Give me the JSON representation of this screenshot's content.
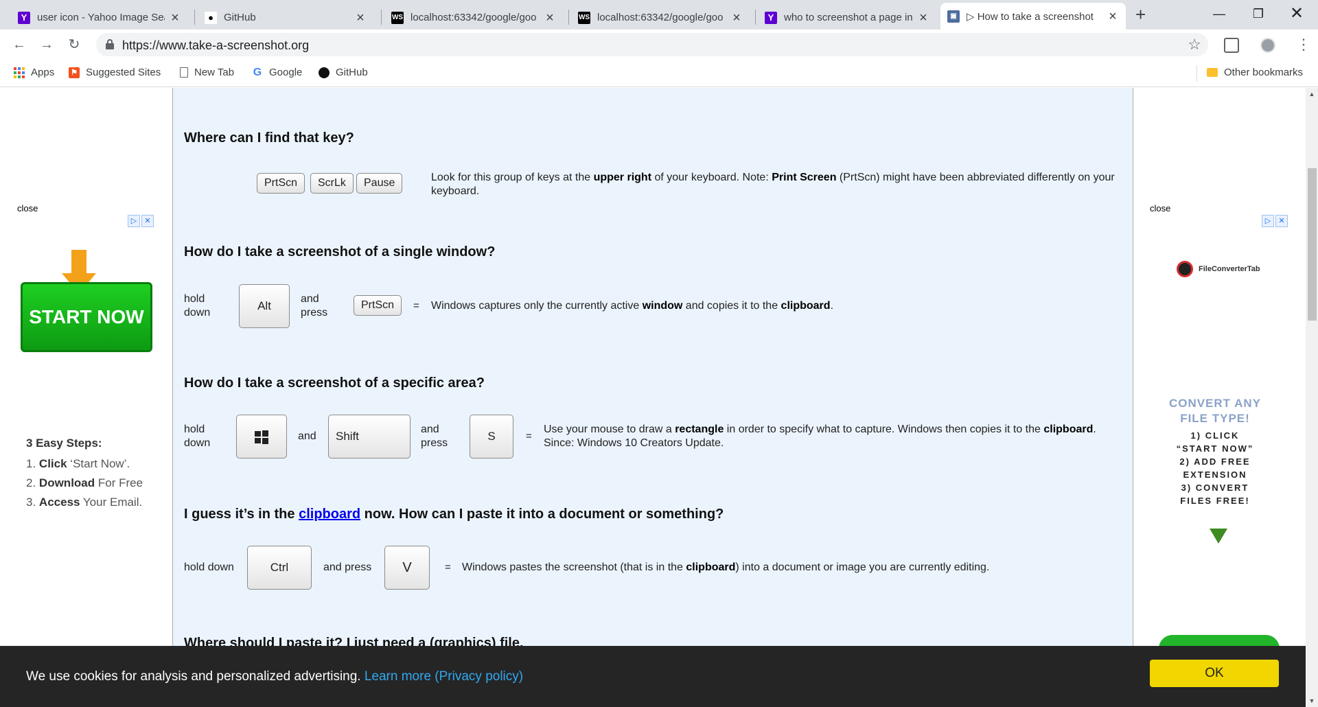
{
  "tabs": [
    {
      "title": "user icon - Yahoo Image Sear",
      "favicon": "yahoo-icon",
      "fav_glyph": "Y"
    },
    {
      "title": "GitHub",
      "favicon": "github-icon",
      "fav_glyph": "●"
    },
    {
      "title": "localhost:63342/google/goo",
      "favicon": "webstorm-icon",
      "fav_glyph": "WS"
    },
    {
      "title": "localhost:63342/google/goo",
      "favicon": "webstorm-icon",
      "fav_glyph": "WS"
    },
    {
      "title": "who to screenshot a page in",
      "favicon": "yahoo-icon",
      "fav_glyph": "Y"
    },
    {
      "title": "▷ How to take a screenshot",
      "favicon": "screenshot-site-icon",
      "fav_glyph": "▣",
      "active": true
    }
  ],
  "browser": {
    "url": "https://www.take-a-screenshot.org",
    "new_tab": "+",
    "close_glyph": "×"
  },
  "bookmarks": {
    "apps": "Apps",
    "suggested": "Suggested Sites",
    "new_tab": "New Tab",
    "google": "Google",
    "github": "GitHub",
    "other": "Other bookmarks"
  },
  "left_ad": {
    "close": "close",
    "cta": "START NOW",
    "steps_title": "3 Easy Steps:",
    "steps": [
      {
        "n": "1.",
        "bold": "Click",
        "rest": "‘Start Now’."
      },
      {
        "n": "2.",
        "bold": "Download",
        "rest": "For Free"
      },
      {
        "n": "3.",
        "bold": "Access",
        "rest": "Your Email."
      }
    ]
  },
  "right_ad": {
    "close": "close",
    "brand": "FileConverterTab",
    "title": "CONVERT ANY FILE TYPE!",
    "steps": [
      "1) CLICK",
      "“START NOW”",
      "2) ADD FREE",
      "EXTENSION",
      "3) CONVERT",
      "FILES FREE!"
    ]
  },
  "article": {
    "q1": "Where can I find that key?",
    "keys1": [
      "PrtScn",
      "ScrLk",
      "Pause"
    ],
    "a1_pre": "Look for this group of keys at the ",
    "a1_b1": "upper right",
    "a1_mid": " of your keyboard. Note: ",
    "a1_b2": "Print Screen",
    "a1_post": " (PrtScn) might have been abbreviated differently on your keyboard.",
    "q2": "How do I take a screenshot of a single window?",
    "s2": {
      "hold_down": "hold down",
      "key_a": "Alt",
      "and_press": "and press",
      "key_b": "PrtScn",
      "eq": "=",
      "pre": "Windows captures only the currently active ",
      "b1": "window",
      "mid": " and copies it to the ",
      "b2": "clipboard",
      "post": "."
    },
    "q3": "How do I take a screenshot of a specific area?",
    "s3": {
      "hold_down": "hold down",
      "and": "and",
      "key_shift": "Shift",
      "and_press": "and press",
      "key_s": "S",
      "eq": "=",
      "pre": "Use your mouse to draw a ",
      "b1": "rectangle",
      "mid": " in order to specify what to capture. Windows then copies it to the ",
      "b2": "clipboard",
      "post": ".",
      "since": "Since: Windows 10 Creators Update."
    },
    "q4_pre": "I guess it’s in the ",
    "q4_link": "clipboard",
    "q4_post": " now. How can I paste it into a document or something?",
    "s4": {
      "hold_down": "hold down",
      "key_a": "Ctrl",
      "and_press": "and press",
      "key_b": "V",
      "eq": "=",
      "pre": "Windows pastes the screenshot (that is in the ",
      "b1": "clipboard",
      "post": ") into a document or image you are currently editing."
    },
    "q5": "Where should I paste it? I just need a (graphics) file."
  },
  "cookie": {
    "text": "We use cookies for analysis and personalized advertising. ",
    "link": "Learn more (Privacy policy)",
    "ok": "OK"
  }
}
